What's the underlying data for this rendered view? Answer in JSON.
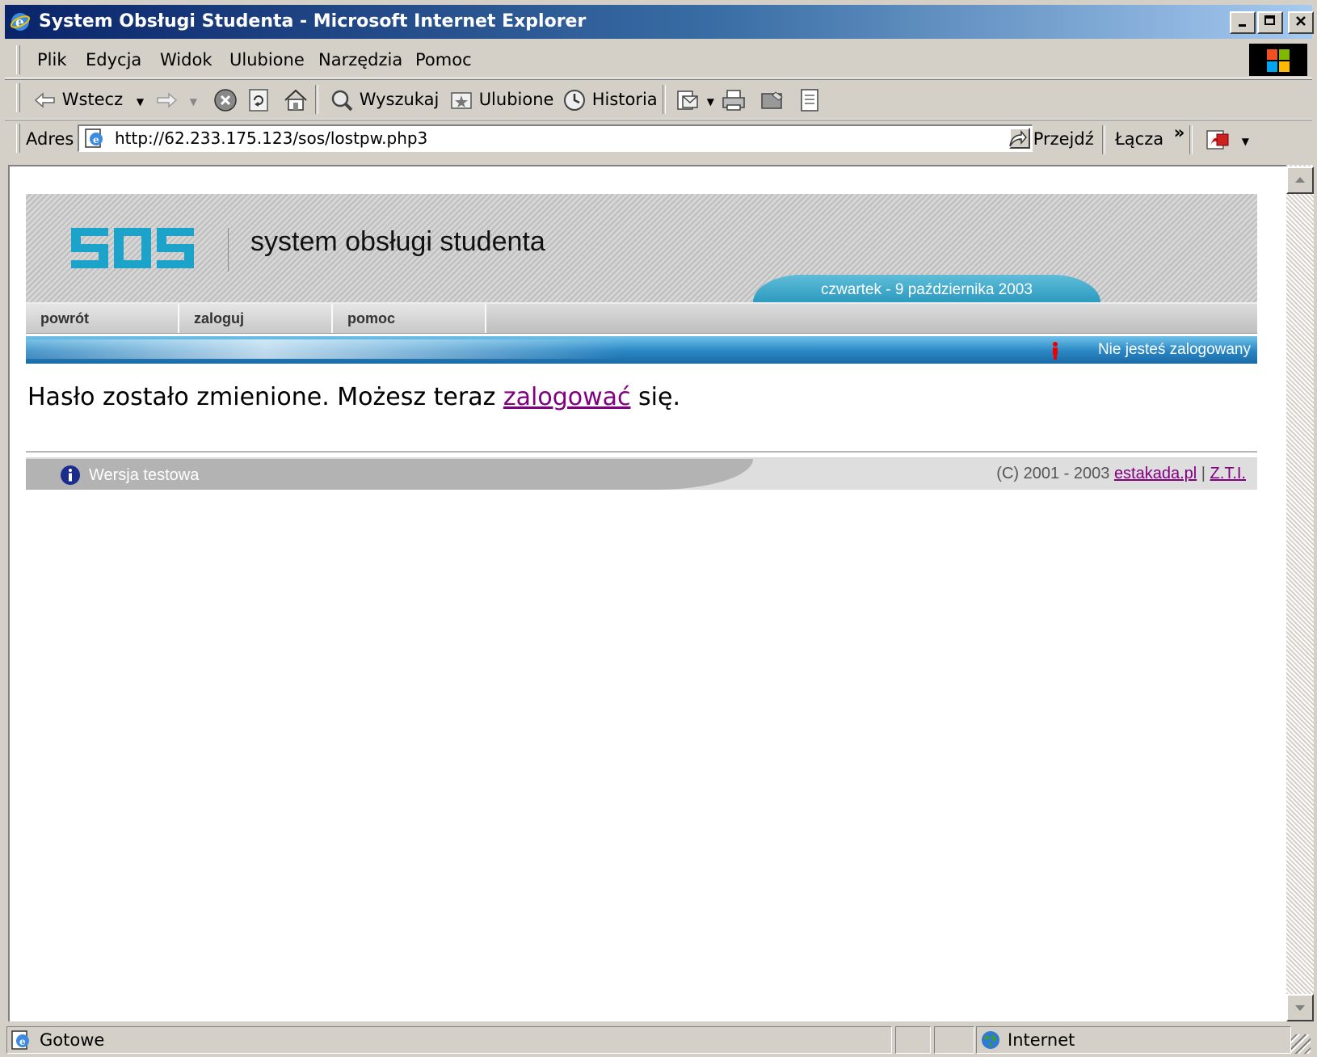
{
  "window": {
    "title": "System Obsługi Studenta - Microsoft Internet Explorer"
  },
  "menu": [
    "Plik",
    "Edycja",
    "Widok",
    "Ulubione",
    "Narzędzia",
    "Pomoc"
  ],
  "toolbar": {
    "back": "Wstecz",
    "search": "Wyszukaj",
    "favorites": "Ulubione",
    "history": "Historia"
  },
  "address": {
    "label": "Adres",
    "url": "http://62.233.175.123/sos/lostpw.php3",
    "go": "Przejdź",
    "links": "Łącza"
  },
  "page": {
    "logo_text": "sos",
    "site_title": "system obsługi studenta",
    "date": "czwartek - 9 października 2003",
    "nav": [
      "powrót",
      "zaloguj",
      "pomoc"
    ],
    "login_status": "Nie jesteś zalogowany",
    "message_before": "Hasło zostało zmienione. Możesz teraz ",
    "message_link": "zalogować",
    "message_after": " się.",
    "footer_version": "Wersja testowa",
    "footer_copyright": "(C) 2001 - 2003 ",
    "footer_link1": "estakada.pl",
    "footer_sep": " | ",
    "footer_link2": "Z.T.I."
  },
  "status": {
    "text": "Gotowe",
    "zone": "Internet"
  },
  "colors": {
    "titlebar": "#0a246a",
    "accent": "#2d9bc0",
    "logo": "#1ba3c9",
    "link": "#800080"
  }
}
